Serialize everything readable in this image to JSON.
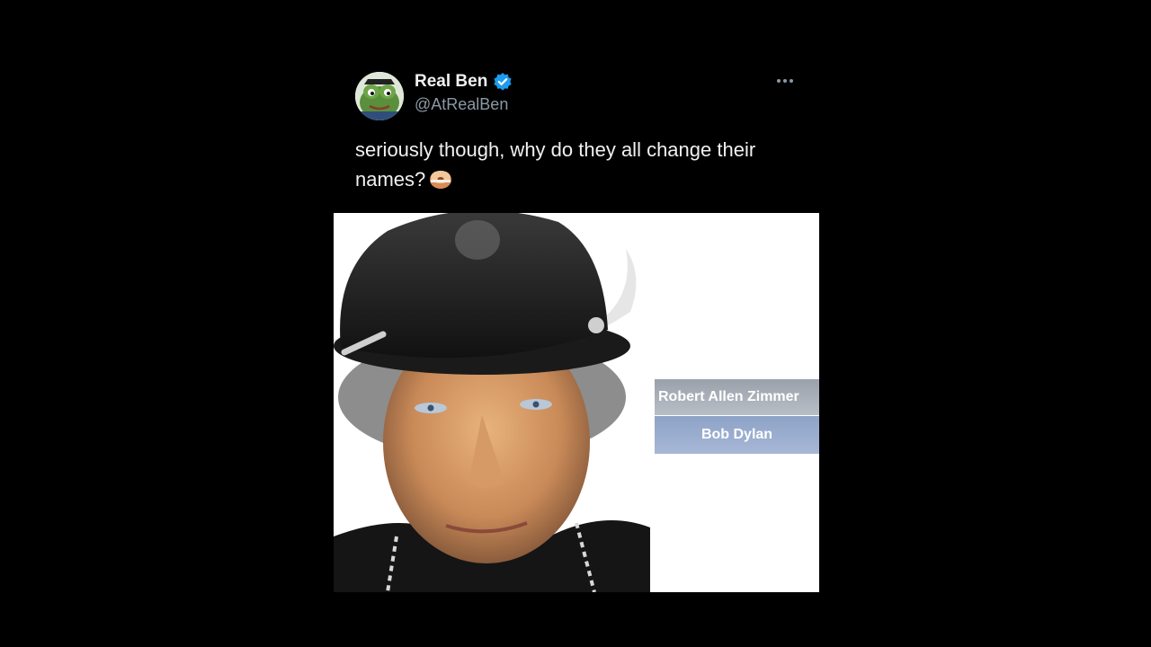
{
  "tweet": {
    "display_name": "Real Ben",
    "handle": "@AtRealBen",
    "verified": true,
    "text": "seriously though, why do they all change their names?",
    "emoji": "bagel-emoji",
    "more_icon": "more-horizontal-icon",
    "avatar_icon": "frog-avatar-icon"
  },
  "media": {
    "name_table": {
      "original_name": "Robert Allen Zimmer",
      "changed_name": "Bob Dylan"
    }
  },
  "colors": {
    "background": "#000000",
    "text": "#f1f1f1",
    "handle": "#8b98a5",
    "verified": "#1d9bf0",
    "table_top": "#a9afb8",
    "table_bottom": "#99acd0"
  }
}
